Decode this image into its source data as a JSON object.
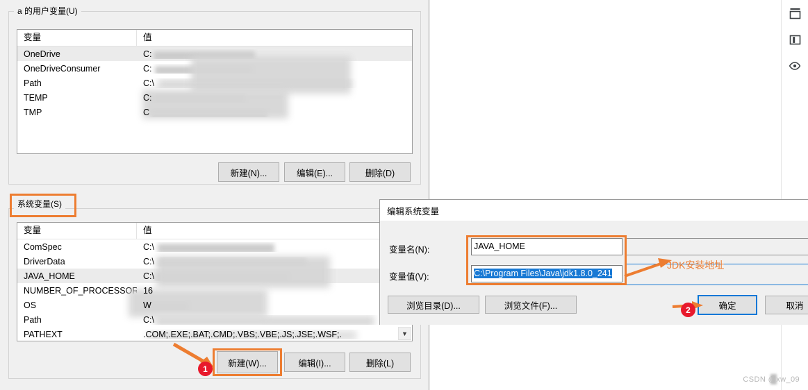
{
  "window": {
    "user_group_legend": "a 的用户变量(U)",
    "system_group_legend": "系统变量(S)"
  },
  "user_variables": {
    "columns": [
      "变量",
      "值"
    ],
    "rows": [
      {
        "name": "OneDrive",
        "value_prefix": "C:",
        "selected": true
      },
      {
        "name": "OneDriveConsumer",
        "value_prefix": "C:",
        "selected": false
      },
      {
        "name": "Path",
        "value_prefix": "C:\\",
        "selected": false
      },
      {
        "name": "TEMP",
        "value_prefix": "C:",
        "selected": false
      },
      {
        "name": "TMP",
        "value_prefix": "C",
        "selected": false
      }
    ],
    "buttons": {
      "new": "新建(N)...",
      "edit": "编辑(E)...",
      "delete": "删除(D)"
    }
  },
  "system_variables": {
    "columns": [
      "变量",
      "值"
    ],
    "rows": [
      {
        "name": "ComSpec",
        "value_prefix": "C:\\",
        "selected": false
      },
      {
        "name": "DriverData",
        "value_prefix": "C:\\",
        "selected": false
      },
      {
        "name": "JAVA_HOME",
        "value_prefix": "C:\\",
        "selected": true
      },
      {
        "name": "NUMBER_OF_PROCESSORS",
        "value_prefix": "16",
        "selected": false
      },
      {
        "name": "OS",
        "value_prefix": "W",
        "selected": false
      },
      {
        "name": "Path",
        "value_prefix": "C:\\",
        "selected": false
      },
      {
        "name": "PATHEXT",
        "value_prefix": ".COM;.EXE;.BAT;.CMD;.VBS;.VBE;.JS;.JSE;.WSF;.",
        "selected": false
      }
    ],
    "buttons": {
      "new": "新建(W)...",
      "edit": "编辑(I)...",
      "delete": "删除(L)"
    }
  },
  "edit_dialog": {
    "title": "编辑系统变量",
    "variable_name_label": "变量名(N):",
    "variable_name_value": "JAVA_HOME",
    "variable_value_label": "变量值(V):",
    "variable_value_value": "C:\\Program Files\\Java\\jdk1.8.0_241",
    "buttons": {
      "browse_dir": "浏览目录(D)...",
      "browse_file": "浏览文件(F)...",
      "ok": "确定",
      "cancel": "取消"
    }
  },
  "annotations": {
    "badge_1": "1",
    "badge_2": "2",
    "jdk_note": "JDK安装地址"
  },
  "right_rail": {
    "icons": [
      "panel-top-icon",
      "split-columns-icon",
      "eye-icon"
    ]
  },
  "watermark": "CSDN @xw_09",
  "colors": {
    "highlight_orange": "#ed7d31",
    "badge_red": "#e8192c",
    "selection_blue": "#1879d4",
    "focus_blue": "#0078d7",
    "window_bg": "#f0f0f0"
  }
}
